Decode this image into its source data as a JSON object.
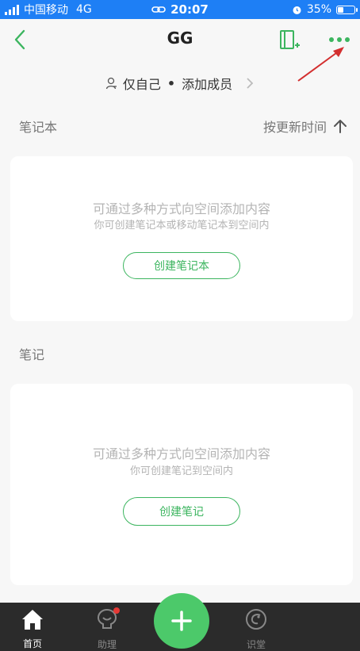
{
  "status_bar": {
    "carrier": "中国移动",
    "network": "4G",
    "time": "20:07",
    "battery": "35%",
    "battery_level": 0.35
  },
  "header": {
    "title": "GG",
    "back_icon": "chevron-left-icon",
    "add_icon": "add-notebook-icon",
    "more_icon": "more-dots-icon"
  },
  "members": {
    "visibility": "仅自己",
    "add_member": "添加成员"
  },
  "notebook_section": {
    "title": "笔记本",
    "sort_label": "按更新时间",
    "hint": "可通过多种方式向空间添加内容",
    "sub_hint": "你可创建笔记本或移动笔记本到空间内",
    "button": "创建笔记本"
  },
  "note_section": {
    "title": "笔记",
    "hint": "可通过多种方式向空间添加内容",
    "sub_hint": "你可创建笔记到空间内",
    "button": "创建笔记"
  },
  "tabs": [
    {
      "label": "首页",
      "icon": "home-icon",
      "active": true
    },
    {
      "label": "助理",
      "icon": "lightbulb-icon",
      "active": false
    },
    {
      "label": "识堂",
      "icon": "compass-icon",
      "active": false
    }
  ],
  "colors": {
    "accent": "#3cb55f",
    "status_bar": "#1e7ff5",
    "annotation_arrow": "#d32f2f"
  }
}
